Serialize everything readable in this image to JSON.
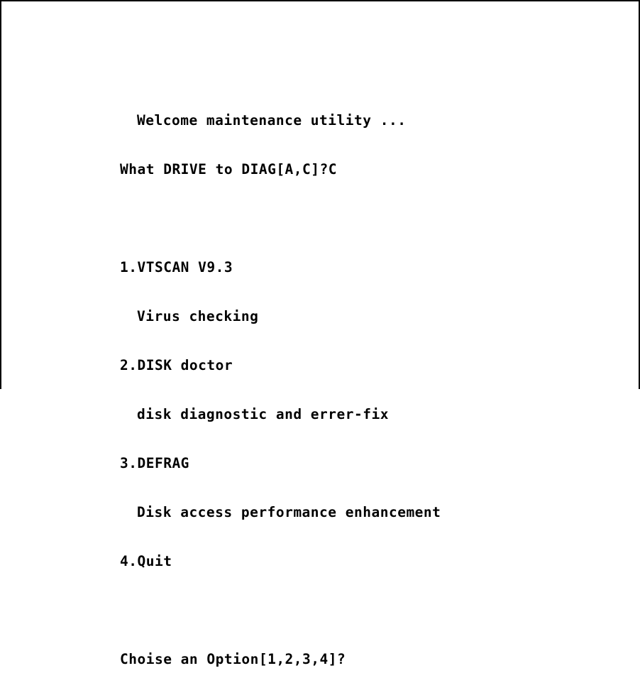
{
  "screen": {
    "welcome": "Welcome maintenance utility ...",
    "drive_prompt": "What DRIVE to DIAG[A,C]?",
    "drive_answer": "C",
    "menu": [
      {
        "label": "1.VTSCAN V9.3",
        "description": "Virus checking"
      },
      {
        "label": "2.DISK doctor",
        "description": "disk diagnostic and errer-fix"
      },
      {
        "label": "3.DEFRAG",
        "description": "Disk access performance enhancement"
      },
      {
        "label": "4.Quit"
      }
    ],
    "option_prompt": "Choise an Option[1,2,3,4]?"
  },
  "colors": {
    "background": "#ffffff",
    "text": "#000000",
    "border": "#000000"
  }
}
